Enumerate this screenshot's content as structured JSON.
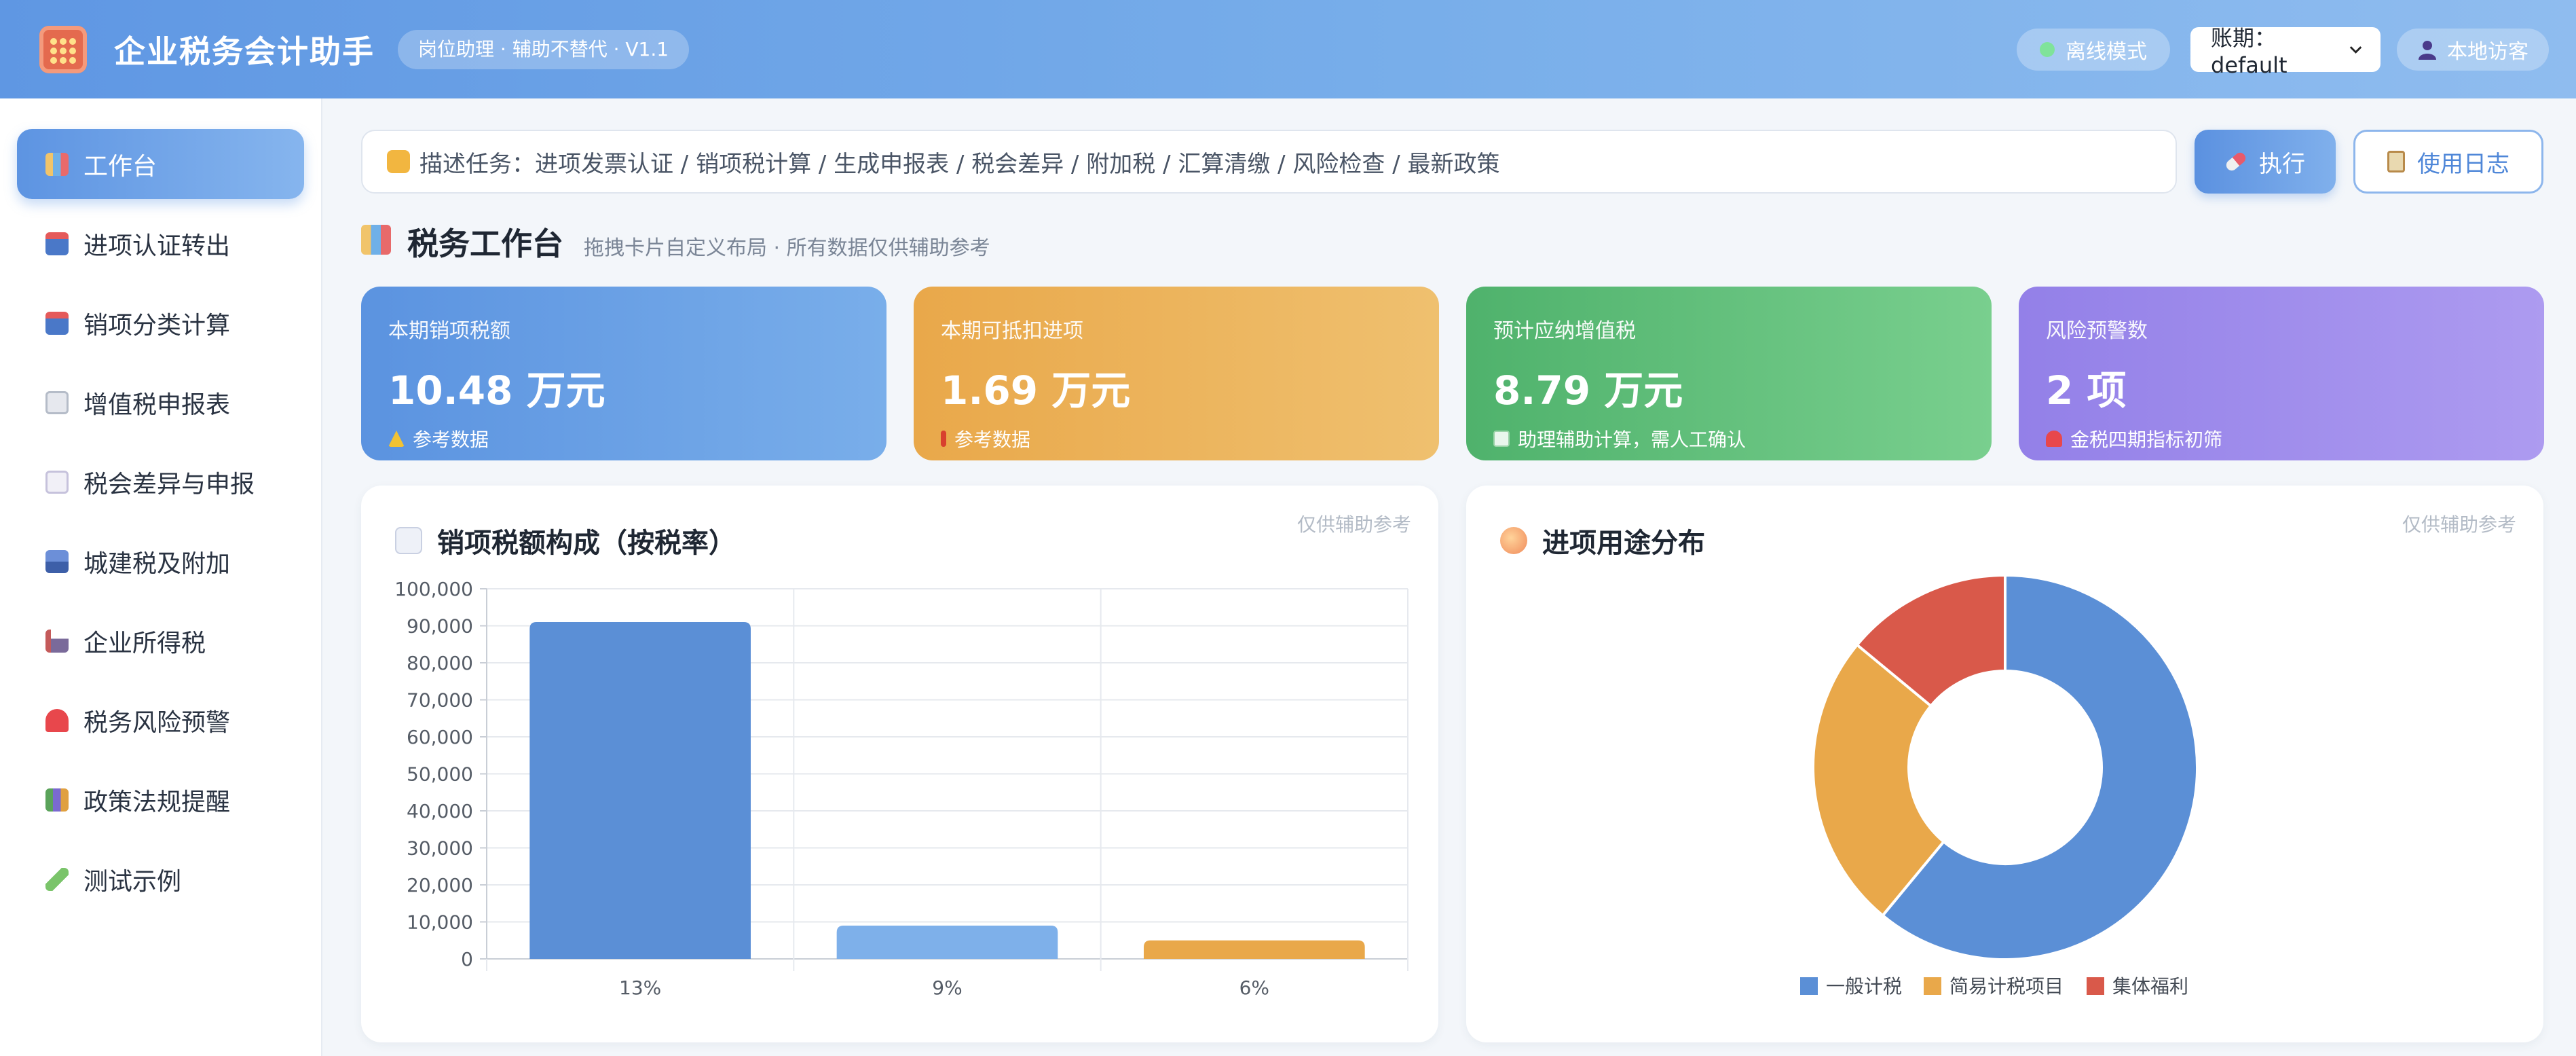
{
  "header": {
    "app_title": "企业税务会计助手",
    "version_badge": "岗位助理 · 辅助不替代 · V1.1",
    "offline_label": "离线模式",
    "period_label": "账期：default",
    "user_label": "本地访客",
    "accent_color": "#5f97e3"
  },
  "sidebar": {
    "items": [
      {
        "label": "工作台",
        "icon": "bar-chart-icon",
        "active": true
      },
      {
        "label": "进项认证转出",
        "icon": "inbox-tray-icon"
      },
      {
        "label": "销项分类计算",
        "icon": "outbox-tray-icon"
      },
      {
        "label": "增值税申报表",
        "icon": "receipt-icon"
      },
      {
        "label": "税会差异与申报",
        "icon": "document-icon"
      },
      {
        "label": "城建税及附加",
        "icon": "cityscape-icon"
      },
      {
        "label": "企业所得税",
        "icon": "factory-icon"
      },
      {
        "label": "税务风险预警",
        "icon": "alarm-light-icon"
      },
      {
        "label": "政策法规提醒",
        "icon": "books-icon"
      },
      {
        "label": "测试示例",
        "icon": "test-tube-icon"
      }
    ]
  },
  "command": {
    "placeholder": "描述任务：进项发票认证 / 销项税计算 / 生成申报表 / 税会差异 / 附加税 / 汇算清缴 / 风险检查 / 最新政策",
    "execute_label": "执行",
    "log_label": "使用日志"
  },
  "section": {
    "title": "税务工作台",
    "subtitle": "拖拽卡片自定义布局 · 所有数据仅供辅助参考"
  },
  "kpis": [
    {
      "label": "本期销项税额",
      "value": "10.48 万元",
      "note": "参考数据",
      "color_from": "#5b93e0",
      "color_to": "#79aeea"
    },
    {
      "label": "本期可抵扣进项",
      "value": "1.69 万元",
      "note": "参考数据",
      "color_from": "#e9a84a",
      "color_to": "#efc06f"
    },
    {
      "label": "预计应纳增值税",
      "value": "8.79 万元",
      "note": "助理辅助计算，需人工确认",
      "color_from": "#4fb26c",
      "color_to": "#79cf8e"
    },
    {
      "label": "风险预警数",
      "value": "2 项",
      "note": "金税四期指标初筛",
      "color_from": "#9380e8",
      "color_to": "#ad9bf0"
    }
  ],
  "bar_card": {
    "title": "销项税额构成（按税率）",
    "note": "仅供辅助参考"
  },
  "pie_card": {
    "title": "进项用途分布",
    "note": "仅供辅助参考"
  },
  "chart_data": [
    {
      "type": "bar",
      "categories": [
        "13%",
        "9%",
        "6%"
      ],
      "values": [
        91000,
        9000,
        5000
      ],
      "colors": [
        "#5b8fd6",
        "#7eb0ea",
        "#e9a84a"
      ],
      "ylim": [
        0,
        100000
      ],
      "yticks": [
        "0",
        "10,000",
        "20,000",
        "30,000",
        "40,000",
        "50,000",
        "60,000",
        "70,000",
        "80,000",
        "90,000",
        "100,000"
      ],
      "grid": true
    },
    {
      "type": "pie",
      "donut": true,
      "labels": [
        "一般计税",
        "简易计税项目",
        "集体福利"
      ],
      "values": [
        61,
        25,
        14
      ],
      "colors": [
        "#5b8fd6",
        "#e9a84a",
        "#d9594a"
      ],
      "legend": "bottom"
    }
  ]
}
